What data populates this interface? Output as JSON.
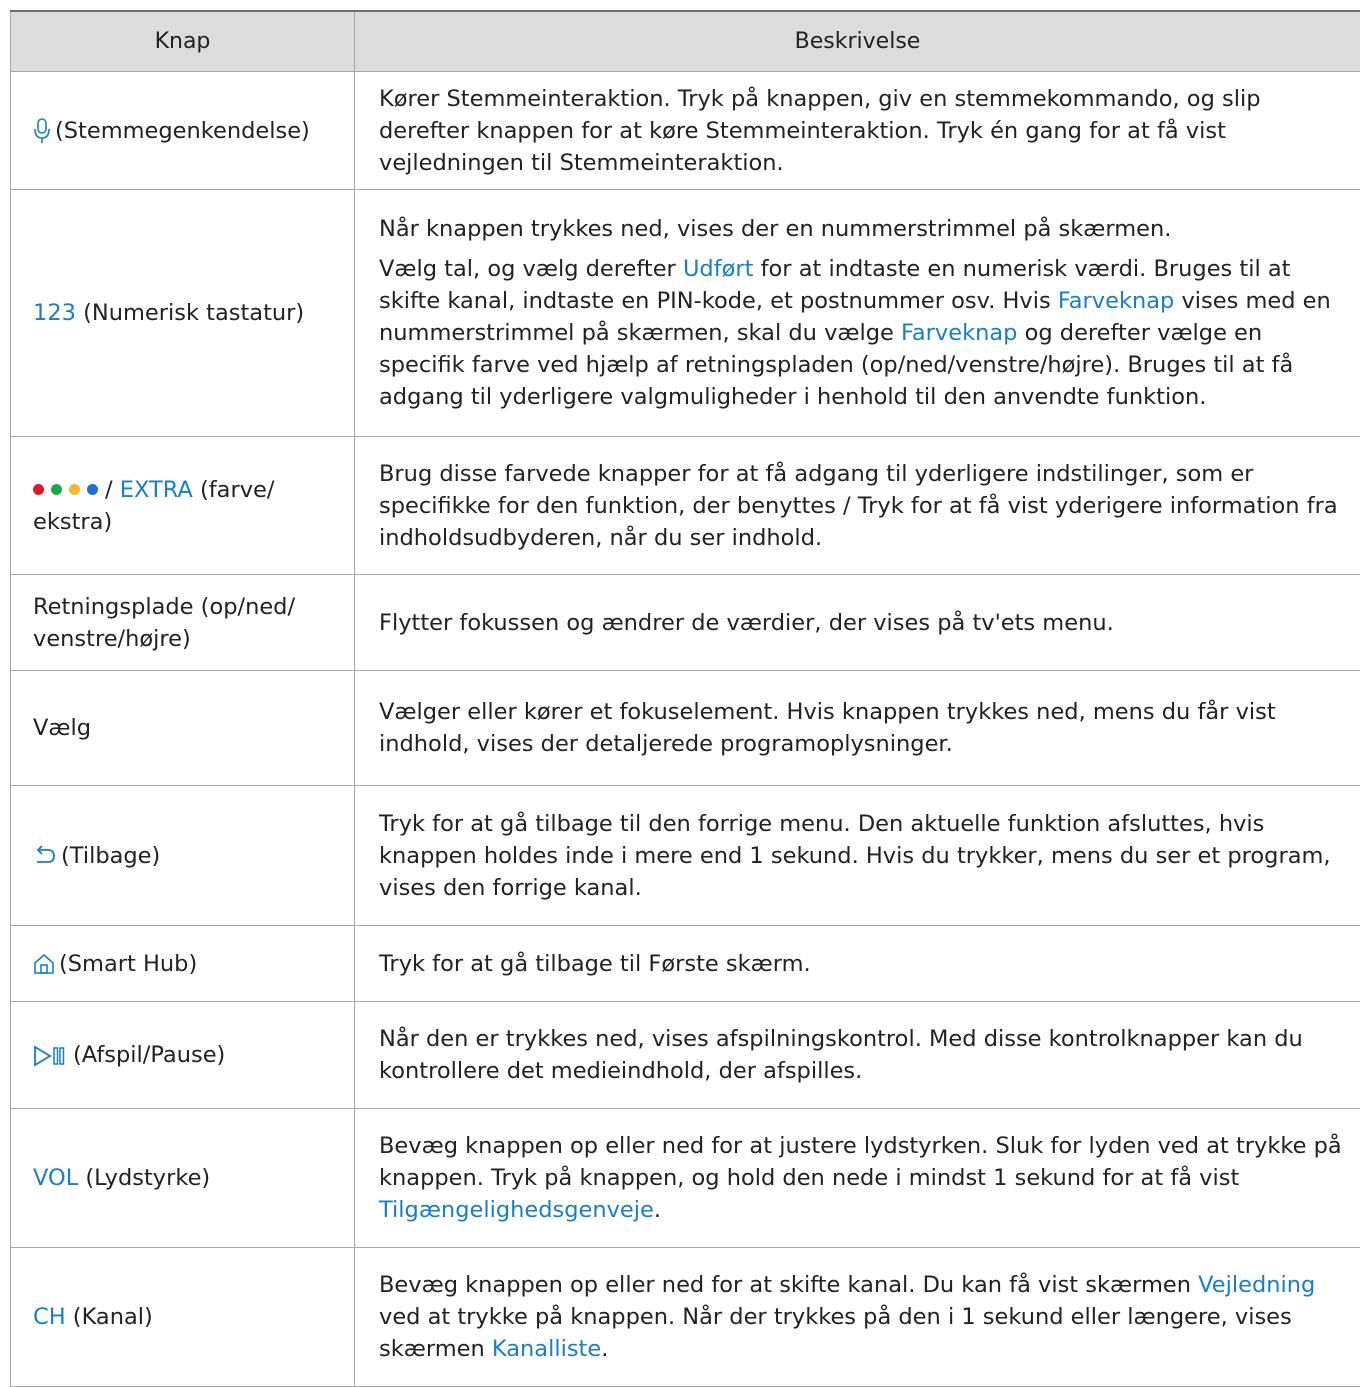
{
  "header": {
    "key_col": "Knap",
    "desc_col": "Beskrivelse"
  },
  "colors": {
    "link": "#1a7fc2",
    "dot_red": "#e0182a",
    "dot_green": "#1ea64a",
    "dot_yellow": "#f5b82a",
    "dot_blue": "#1f6fd0"
  },
  "rows": [
    {
      "icon": "microphone-icon",
      "key_label": "(Stemmegenkendelse)",
      "desc": "Kører Stemmeinteraktion. Tryk på knappen, giv en stemmekommando, og slip derefter knappen for at køre Stemmeinteraktion. Tryk én gang for at få vist vejledningen til Stemmeinteraktion."
    },
    {
      "key_hl": "123",
      "key_label": " (Numerisk tastatur)",
      "desc_line1": "Når knappen trykkes ned, vises der en nummerstrimmel på skærmen.",
      "desc_p2_a": "Vælg tal, og vælg derefter ",
      "desc_p2_link1": "Udført",
      "desc_p2_b": " for at indtaste en numerisk værdi. Bruges til at skifte kanal, indtaste en PIN-kode, et postnummer osv. Hvis ",
      "desc_p2_link2": "Farveknap",
      "desc_p2_c": " vises med en nummerstrimmel på skærmen, skal du vælge ",
      "desc_p2_link3": "Farveknap",
      "desc_p2_d": " og derefter vælge en specifik farve ved hjælp af retningspladen (op/ned/venstre/højre). Bruges til at få adgang til yderligere valgmuligheder i henhold til den anvendte funktion."
    },
    {
      "icon": "color-dots-icon",
      "key_sep": "/ ",
      "key_hl": "EXTRA",
      "key_label": " (farve/ ekstra)",
      "desc": "Brug disse farvede knapper for at få adgang til yderligere indstilinger, som er specifikke for den funktion, der benyttes / Tryk for at få vist yderigere information fra indholdsudbyderen, når du ser indhold."
    },
    {
      "key_label": "Retningsplade (op/ned/ venstre/højre)",
      "desc": "Flytter fokussen og ændrer de værdier, der vises på tv'ets menu."
    },
    {
      "key_label": "Vælg",
      "desc": "Vælger eller kører et fokuselement. Hvis knappen trykkes ned, mens du får vist indhold, vises der detaljerede programoplysninger."
    },
    {
      "icon": "back-arrow-icon",
      "key_label": "(Tilbage)",
      "desc": "Tryk for at gå tilbage til den forrige menu. Den aktuelle funktion afsluttes, hvis knappen holdes inde i mere end 1 sekund. Hvis du trykker, mens du ser et program, vises den forrige kanal."
    },
    {
      "icon": "home-icon",
      "key_label": "(Smart Hub)",
      "desc": "Tryk for at gå tilbage til Første skærm."
    },
    {
      "icon": "play-pause-icon",
      "key_label": "(Afspil/Pause)",
      "desc": "Når den er trykkes ned, vises afspilningskontrol. Med disse kontrolknapper kan du kontrollere det medieindhold, der afspilles."
    },
    {
      "key_hl": "VOL",
      "key_label": " (Lydstyrke)",
      "desc_a": "Bevæg knappen op eller ned for at justere lydstyrken. Sluk for lyden ved at trykke på knappen. Tryk på knappen, og hold den nede i mindst 1 sekund for at få vist ",
      "desc_link1": "Tilgængelighedsgenveje",
      "desc_b": "."
    },
    {
      "key_hl": "CH",
      "key_label": " (Kanal)",
      "desc_a": "Bevæg knappen op eller ned for at skifte kanal. Du kan få vist skærmen ",
      "desc_link1": "Vejledning",
      "desc_b": " ved at trykke på knappen. Når der trykkes på den i 1 sekund eller længere, vises skærmen ",
      "desc_link2": "Kanalliste",
      "desc_c": "."
    }
  ]
}
